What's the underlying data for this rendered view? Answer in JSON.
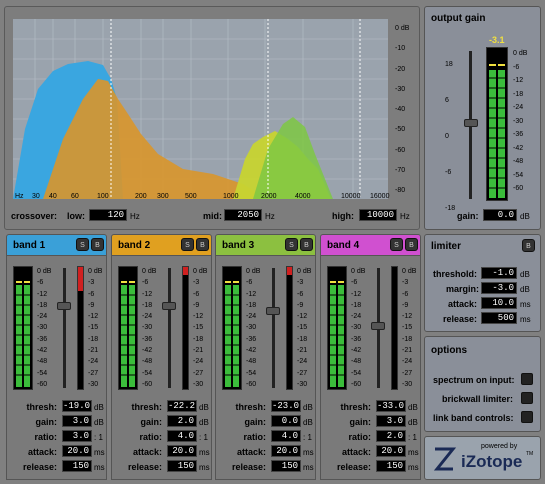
{
  "spectrum": {
    "db_labels": [
      "0 dB",
      "-10",
      "-20",
      "-30",
      "-40",
      "-50",
      "-60",
      "-70",
      "-80"
    ],
    "freq_labels": [
      "Hz",
      "30",
      "40",
      "60",
      "100",
      "200",
      "300",
      "500",
      "1000",
      "2000",
      "4000",
      "10000",
      "16000"
    ]
  },
  "crossover": {
    "label": "crossover:",
    "low_label": "low:",
    "low_value": "120",
    "mid_label": "mid:",
    "mid_value": "2050",
    "high_label": "high:",
    "high_value": "10000",
    "unit": "Hz"
  },
  "output_gain": {
    "title": "output gain",
    "peak": "-3.1",
    "scale_left": [
      "18",
      "6",
      "0",
      "-6",
      "-18"
    ],
    "scale_right": [
      "0 dB",
      "-6",
      "-12",
      "-18",
      "-24",
      "-30",
      "-36",
      "-42",
      "-48",
      "-54",
      "-60"
    ],
    "gain_label": "gain:",
    "gain_value": "0.0",
    "gain_unit": "dB"
  },
  "limiter": {
    "title": "limiter",
    "threshold_label": "threshold:",
    "threshold_value": "-1.0",
    "threshold_unit": "dB",
    "margin_label": "margin:",
    "margin_value": "-3.0",
    "margin_unit": "dB",
    "attack_label": "attack:",
    "attack_value": "10.0",
    "attack_unit": "ms",
    "release_label": "release:",
    "release_value": "500",
    "release_unit": "ms"
  },
  "options": {
    "title": "options",
    "spectrum_label": "spectrum on input:",
    "brickwall_label": "brickwall limiter:",
    "link_label": "link band controls:"
  },
  "logo": {
    "powered": "powered by",
    "name": "iZotope",
    "tm": "TM"
  },
  "solo": "S",
  "bypass": "B",
  "band_scale_left": [
    "0 dB",
    "-6",
    "-12",
    "-18",
    "-24",
    "-30",
    "-36",
    "-42",
    "-48",
    "-54",
    "-60"
  ],
  "band_scale_right": [
    "0 dB",
    "-3",
    "-6",
    "-9",
    "-12",
    "-15",
    "-18",
    "-21",
    "-24",
    "-27",
    "-30"
  ],
  "labels": {
    "thresh": "thresh:",
    "gain": "gain:",
    "ratio": "ratio:",
    "attack": "attack:",
    "release": "release:",
    "db": "dB",
    "ratio_unit": ": 1",
    "ms": "ms"
  },
  "bands": [
    {
      "title": "band 1",
      "color": "#3aa0d8",
      "thresh": "-19.0",
      "gain": "3.0",
      "ratio": "3.0",
      "attack": "20.0",
      "release": "150"
    },
    {
      "title": "band 2",
      "color": "#e0a020",
      "thresh": "-22.2",
      "gain": "2.0",
      "ratio": "4.0",
      "attack": "20.0",
      "release": "150"
    },
    {
      "title": "band 3",
      "color": "#8cc040",
      "thresh": "-23.0",
      "gain": "0.0",
      "ratio": "4.0",
      "attack": "20.0",
      "release": "150"
    },
    {
      "title": "band 4",
      "color": "#d050d0",
      "thresh": "-33.0",
      "gain": "3.0",
      "ratio": "2.0",
      "attack": "20.0",
      "release": "150"
    }
  ]
}
